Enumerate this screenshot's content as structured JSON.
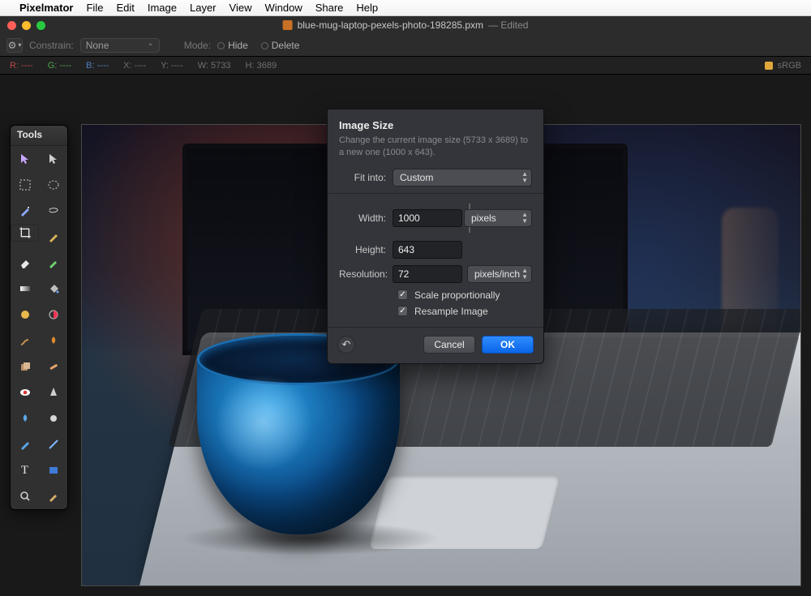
{
  "menubar": {
    "app": "Pixelmator",
    "items": [
      "File",
      "Edit",
      "Image",
      "Layer",
      "View",
      "Window",
      "Share",
      "Help"
    ]
  },
  "window": {
    "filename": "blue-mug-laptop-pexels-photo-198285.pxm",
    "edited": "— Edited"
  },
  "toolbar": {
    "constrain_label": "Constrain:",
    "constrain_value": "None",
    "mode_label": "Mode:",
    "hide_label": "Hide",
    "delete_label": "Delete"
  },
  "infobar": {
    "r": "R: ----",
    "g": "G: ----",
    "b": "B: ----",
    "x": "X: ----",
    "y": "Y: ----",
    "w": "W:  5733",
    "h": "H:  3689",
    "srgb": "sRGB"
  },
  "toolsPanel": {
    "title": "Tools"
  },
  "dialog": {
    "title": "Image Size",
    "desc": "Change the current image size (5733 x 3689) to a new one (1000 x 643).",
    "fitinto_label": "Fit into:",
    "fitinto_value": "Custom",
    "width_label": "Width:",
    "width_value": "1000",
    "height_label": "Height:",
    "height_value": "643",
    "wh_unit": "pixels",
    "res_label": "Resolution:",
    "res_value": "72",
    "res_unit": "pixels/inch",
    "scale_label": "Scale proportionally",
    "resample_label": "Resample Image",
    "cancel": "Cancel",
    "ok": "OK"
  }
}
